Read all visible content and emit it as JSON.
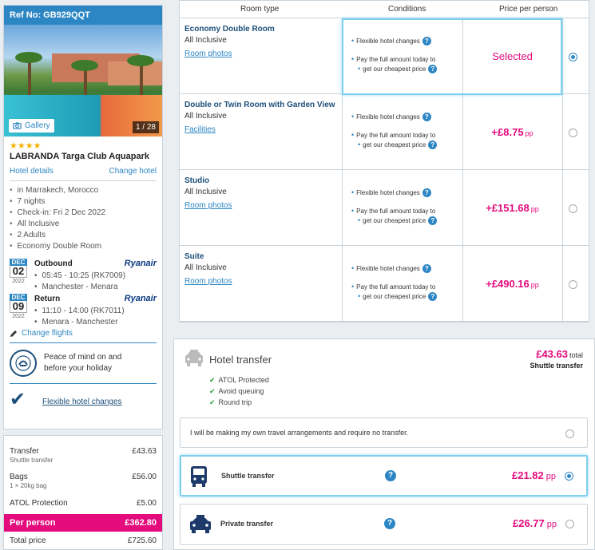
{
  "sidebar": {
    "ref": "Ref No: GB929QQT",
    "gallery_label": "Gallery",
    "photo_count": "1 / 28",
    "stars": "★★★★",
    "hotel_name": "LABRANDA Targa Club Aquapark",
    "hotel_details": "Hotel details",
    "change_hotel": "Change hotel",
    "details": [
      "in Marrakech, Morocco",
      "7 nights",
      "Check-in: Fri 2 Dec 2022",
      "All Inclusive",
      "2 Adults",
      "Economy Double Room"
    ],
    "outbound": {
      "month": "DEC",
      "day": "02",
      "year": "2022",
      "label": "Outbound",
      "airline": "Ryanair",
      "times": "05:45 - 10:25 (RK7009)",
      "route": "Manchester - Menara"
    },
    "return": {
      "month": "DEC",
      "day": "09",
      "year": "2022",
      "label": "Return",
      "airline": "Ryanair",
      "times": "11:10 - 14:00 (RK7011)",
      "route": "Menara - Manchester"
    },
    "change_flights": "Change flights",
    "peace_line1": "Peace of mind on and",
    "peace_line2": "before your holiday",
    "flexible_changes": "Flexible hotel changes"
  },
  "summary": {
    "transfer_label": "Transfer",
    "transfer_value": "£43.63",
    "transfer_sub": "Shuttle transfer",
    "bags_label": "Bags",
    "bags_value": "£56.00",
    "bags_sub": "1 × 20kg bag",
    "atol_label": "ATOL Protection",
    "atol_value": "£5.00",
    "per_person_label": "Per person",
    "per_person_value": "£362.80",
    "total_label": "Total price",
    "total_value": "£725.60"
  },
  "rooms": {
    "headers": [
      "Room type",
      "Conditions",
      "Price per person"
    ],
    "cond_flex": "Flexible hotel changes",
    "cond_pay1": "Pay the full amount today to",
    "cond_pay2": "get our cheapest price",
    "pp": "pp",
    "items": [
      {
        "name": "Economy Double Room",
        "board": "All Inclusive",
        "link": "Room photos",
        "price": "Selected",
        "selected": true
      },
      {
        "name": "Double or Twin Room with Garden View",
        "board": "All Inclusive",
        "link": "Facilities",
        "price": "+£8.75",
        "selected": false
      },
      {
        "name": "Studio",
        "board": "All Inclusive",
        "link": "Room photos",
        "price": "+£151.68",
        "selected": false
      },
      {
        "name": "Suite",
        "board": "All Inclusive",
        "link": "Room photos",
        "price": "+£490.16",
        "selected": false
      }
    ]
  },
  "transfer": {
    "title": "Hotel transfer",
    "total": "£43.63",
    "total_label": "total",
    "selected_name": "Shuttle transfer",
    "features": [
      "ATOL Protected",
      "Avoid queuing",
      "Round trip"
    ],
    "no_transfer": "I will be making my own travel arrangements and require no transfer.",
    "shuttle_label": "Shuttle transfer",
    "shuttle_price": "£21.82",
    "private_label": "Private transfer",
    "private_price": "£26.77",
    "pp": "pp"
  },
  "colors": {
    "accent": "#2d86c4",
    "price": "#e40b7d",
    "navy": "#1d4f7a"
  }
}
